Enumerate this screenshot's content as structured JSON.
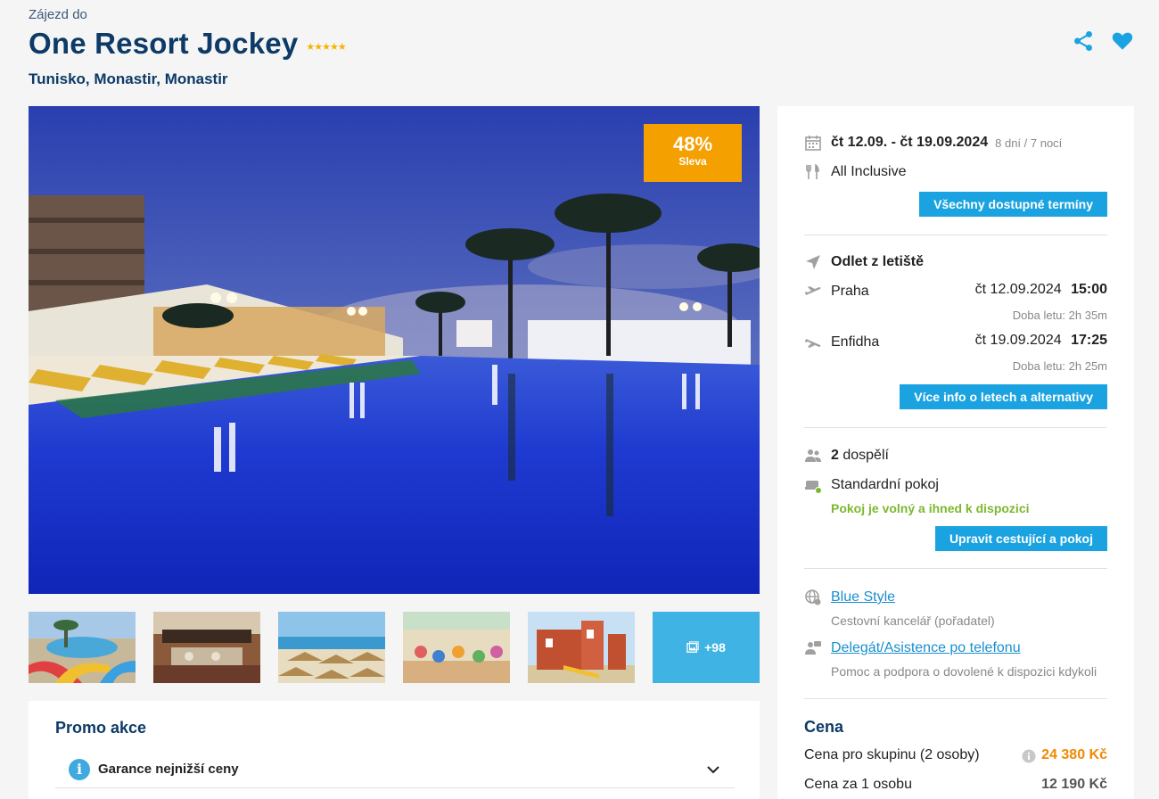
{
  "header": {
    "subtitle": "Zájezd do",
    "title": "One Resort Jockey",
    "stars": "★★★★★",
    "location": "Tunisko, Monastir, Monastir"
  },
  "photo": {
    "discount_pct": "48%",
    "discount_label": "Sleva"
  },
  "gallery": {
    "more_label": "+98"
  },
  "promo": {
    "title": "Promo akce",
    "item_label": "Garance nejnižší ceny"
  },
  "panel": {
    "dates": "čt 12.09. - čt 19.09.2024",
    "duration": "8 dní / 7 nocí",
    "board": "All Inclusive",
    "all_dates_button": "Všechny dostupné termíny",
    "departure_title": "Odlet z letiště",
    "outbound": {
      "city": "Praha",
      "date": "čt 12.09.2024",
      "time": "15:00",
      "duration": "Doba letu: 2h 35m"
    },
    "inbound": {
      "city": "Enfidha",
      "date": "čt 19.09.2024",
      "time": "17:25",
      "duration": "Doba letu: 2h 25m"
    },
    "flights_button": "Více info o letech a alternativy",
    "travelers_count": "2",
    "travelers_label": "dospělí",
    "room": "Standardní pokoj",
    "room_status": "Pokoj je volný a ihned k dispozici",
    "edit_button": "Upravit cestující a pokoj",
    "agency_link": "Blue Style",
    "agency_desc": "Cestovní kancelář (pořadatel)",
    "support_link": "Delegát/Asistence po telefonu",
    "support_desc": "Pomoc a podpora o dovolené k dispozici kdykoli",
    "price_title": "Cena",
    "group_price_label": "Cena pro skupinu (2 osoby)",
    "group_price": "24 380 Kč",
    "person_price_label": "Cena za 1 osobu",
    "person_price": "12 190 Kč"
  },
  "colors": {
    "title": "#0d3a66",
    "accent": "#1aa3e0",
    "discount": "#f4a000",
    "price": "#f08a00",
    "available": "#7cb82f"
  }
}
